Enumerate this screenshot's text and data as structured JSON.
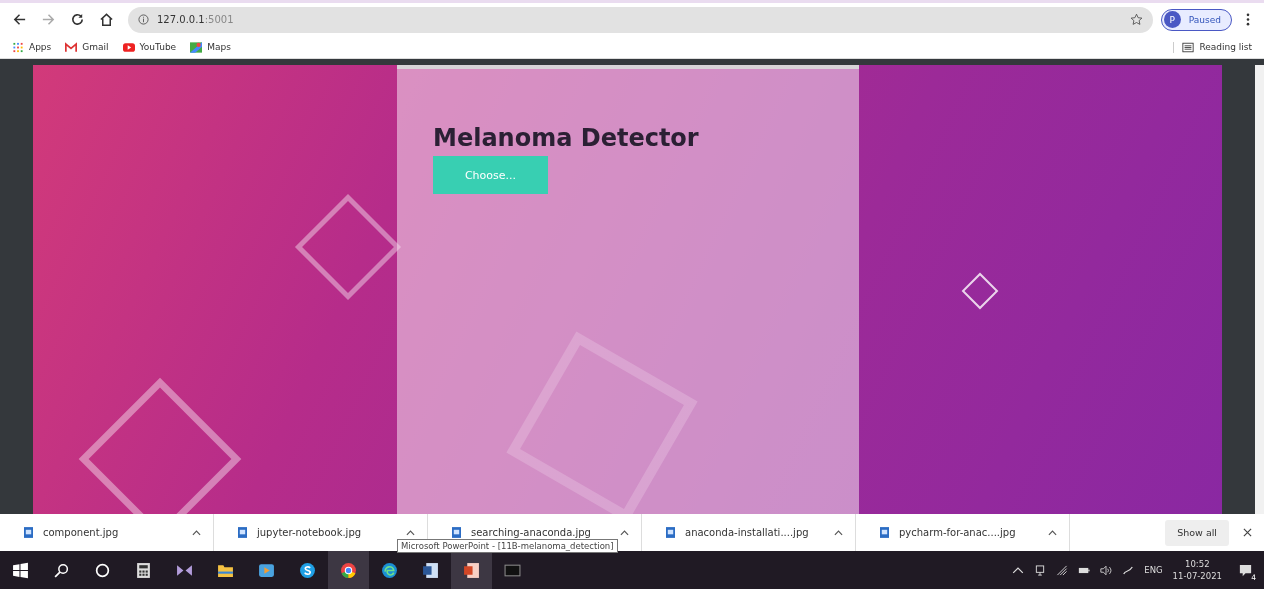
{
  "browser": {
    "url_host": "127.0.0.1",
    "url_port": ":5001",
    "profile_initial": "P",
    "profile_status": "Paused"
  },
  "bookmarks": [
    {
      "label": "Apps"
    },
    {
      "label": "Gmail"
    },
    {
      "label": "YouTube"
    },
    {
      "label": "Maps"
    }
  ],
  "reading_list": "Reading list",
  "page": {
    "title": "Melanoma Detector",
    "button": "Choose..."
  },
  "downloads": [
    {
      "name": "component.jpg"
    },
    {
      "name": "jupyter-notebook.jpg"
    },
    {
      "name": "searching-anaconda.jpg"
    },
    {
      "name": "anaconda-installati....jpg"
    },
    {
      "name": "pycharm-for-anac....jpg"
    }
  ],
  "show_all": "Show all",
  "tooltip": "Microsoft PowerPoint - [11B-melanoma_detection]",
  "taskbar": {
    "apps": [
      {
        "active": false
      },
      {
        "active": false
      },
      {
        "active": false
      },
      {
        "active": false
      },
      {
        "active": false
      },
      {
        "active": false
      },
      {
        "active": false
      },
      {
        "active": false
      },
      {
        "active": true
      },
      {
        "active": false
      },
      {
        "active": false
      },
      {
        "active": true
      },
      {
        "active": false
      }
    ],
    "language": "ENG",
    "time": "10:52",
    "date": "11-07-2021",
    "notifications": "4"
  }
}
